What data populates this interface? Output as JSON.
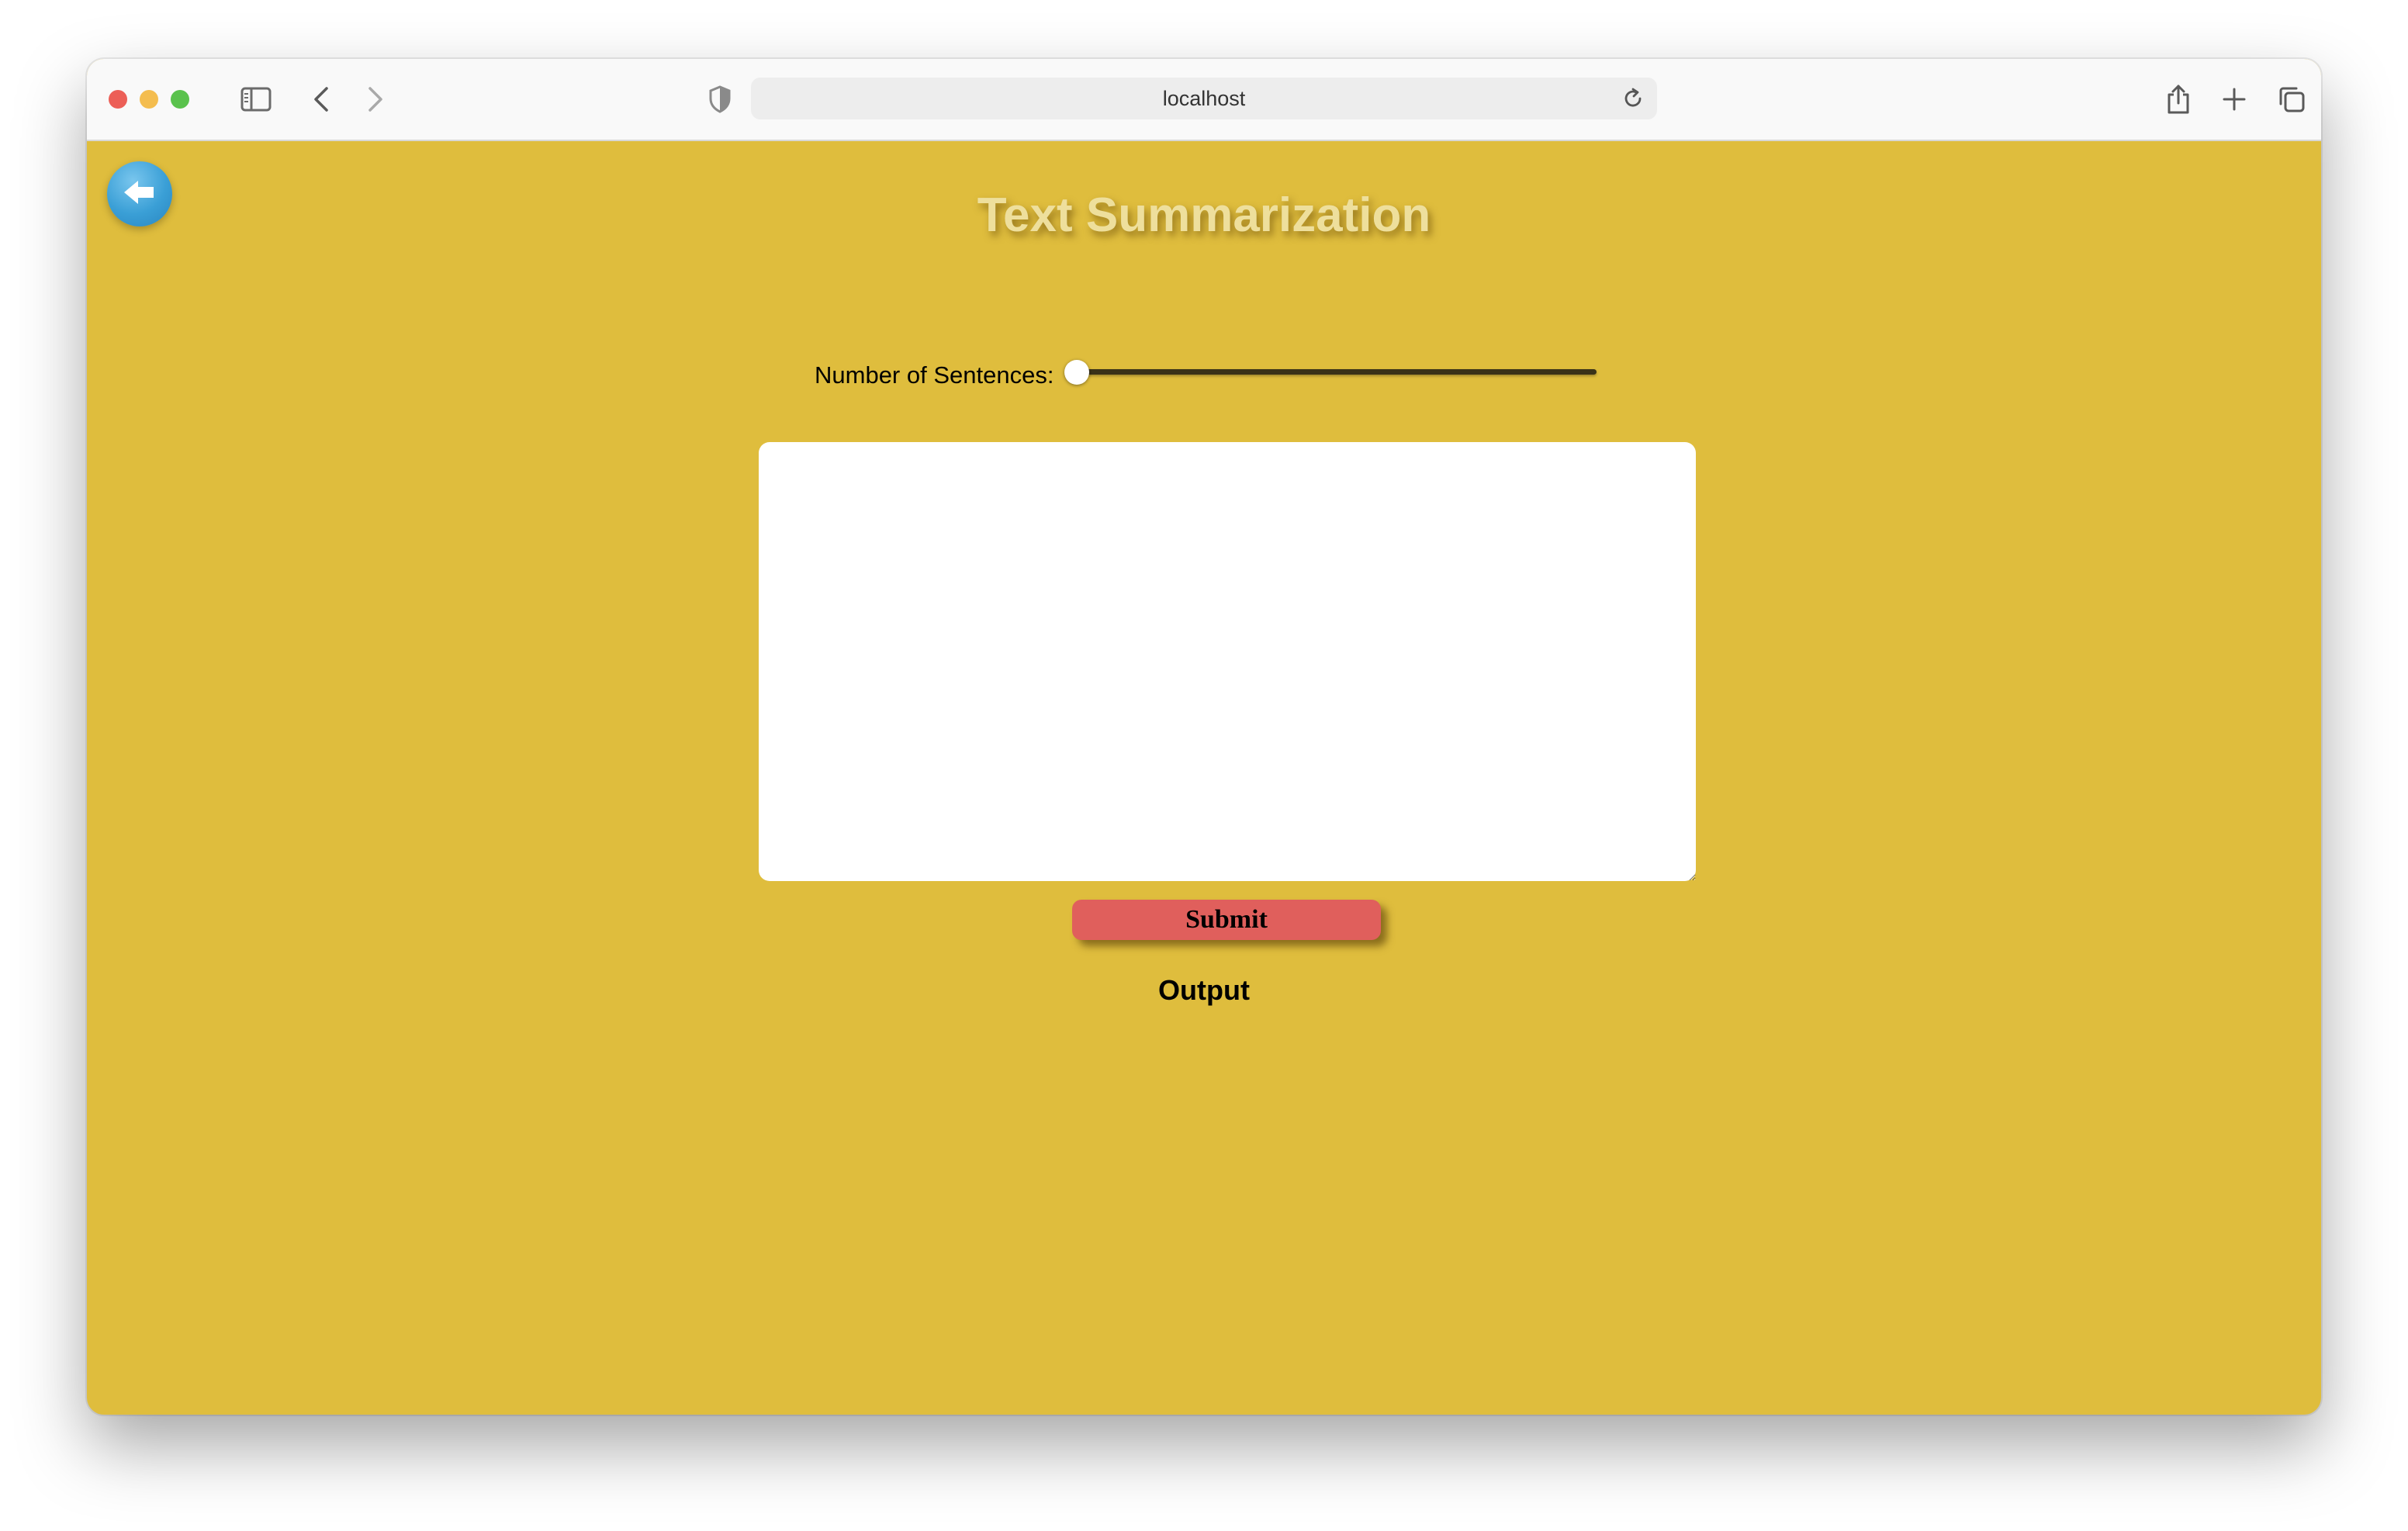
{
  "browser": {
    "address": "localhost",
    "colors": {
      "close": "#ec5f57",
      "minimize": "#f4bd4f",
      "maximize": "#5ac24d",
      "page_background": "#dfbd3d"
    },
    "icons": [
      "sidebar-icon",
      "back-arrow-icon",
      "forward-arrow-icon",
      "shield-icon",
      "reload-icon",
      "share-icon",
      "new-tab-icon",
      "tab-overview-icon"
    ]
  },
  "page": {
    "back_button_icon": "arrow-left-icon",
    "title": "Text Summarization",
    "slider": {
      "label": "Number of Sentences:",
      "value_fraction": 0.0
    },
    "textarea": {
      "value": "",
      "placeholder": ""
    },
    "submit_label": "Submit",
    "output_label": "Output",
    "colors": {
      "title": "#eedf9c",
      "submit": "#e05f5c",
      "back_button": "#3a9fd6"
    }
  }
}
